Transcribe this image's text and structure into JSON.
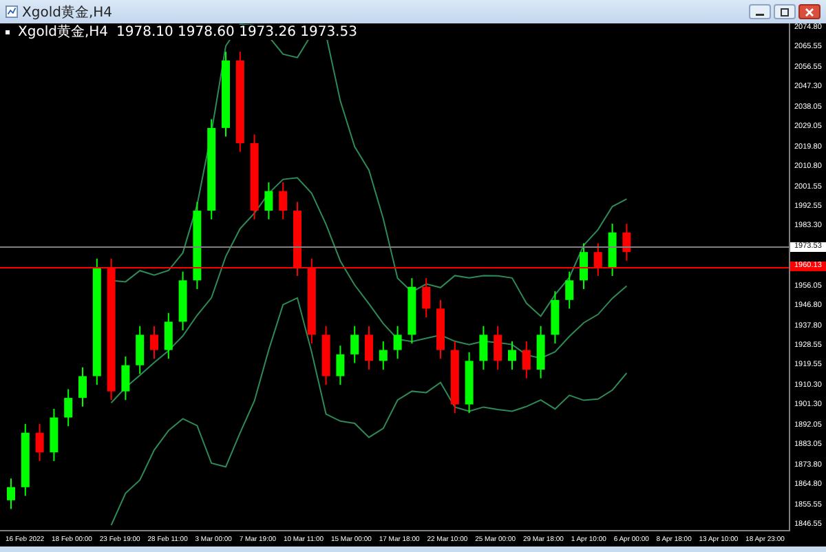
{
  "window": {
    "title": "Xgold黄金,H4"
  },
  "chart": {
    "symbol": "Xgold黄金,H4",
    "quote": "1978.10 1978.60 1973.26 1973.53",
    "price_axis": [
      {
        "kind": "tick",
        "label": "2074.80"
      },
      {
        "kind": "tick",
        "label": "2065.55"
      },
      {
        "kind": "tick",
        "label": "2056.55"
      },
      {
        "kind": "tick",
        "label": "2047.30"
      },
      {
        "kind": "tick",
        "label": "2038.05"
      },
      {
        "kind": "tick",
        "label": "2029.05"
      },
      {
        "kind": "tick",
        "label": "2019.80"
      },
      {
        "kind": "tick",
        "label": "2010.80"
      },
      {
        "kind": "tick",
        "label": "2001.55"
      },
      {
        "kind": "tick",
        "label": "1992.55"
      },
      {
        "kind": "tick",
        "label": "1983.30"
      },
      {
        "kind": "marker",
        "label": "1973.53",
        "color": "#808080"
      },
      {
        "kind": "marker",
        "label": "1960.13",
        "color": "#ff0000"
      },
      {
        "kind": "tick",
        "label": "1956.05"
      },
      {
        "kind": "tick",
        "label": "1946.80"
      },
      {
        "kind": "tick",
        "label": "1937.80"
      },
      {
        "kind": "tick",
        "label": "1928.55"
      },
      {
        "kind": "tick",
        "label": "1919.55"
      },
      {
        "kind": "tick",
        "label": "1910.30"
      },
      {
        "kind": "tick",
        "label": "1901.30"
      },
      {
        "kind": "tick",
        "label": "1892.05"
      },
      {
        "kind": "tick",
        "label": "1883.05"
      },
      {
        "kind": "tick",
        "label": "1873.80"
      },
      {
        "kind": "tick",
        "label": "1864.80"
      },
      {
        "kind": "tick",
        "label": "1855.55"
      },
      {
        "kind": "tick",
        "label": "1846.55"
      }
    ],
    "time_axis": [
      "16 Feb 2022",
      "18 Feb 00:00",
      "23 Feb 19:00",
      "28 Feb 11:00",
      "3 Mar 00:00",
      "7 Mar 19:00",
      "10 Mar 11:00",
      "15 Mar 00:00",
      "17 Mar 18:00",
      "22 Mar 10:00",
      "25 Mar 00:00",
      "29 Mar 18:00",
      "1 Apr 10:00",
      "6 Apr 00:00",
      "8 Apr 18:00",
      "13 Apr 10:00",
      "18 Apr 23:00"
    ]
  }
}
